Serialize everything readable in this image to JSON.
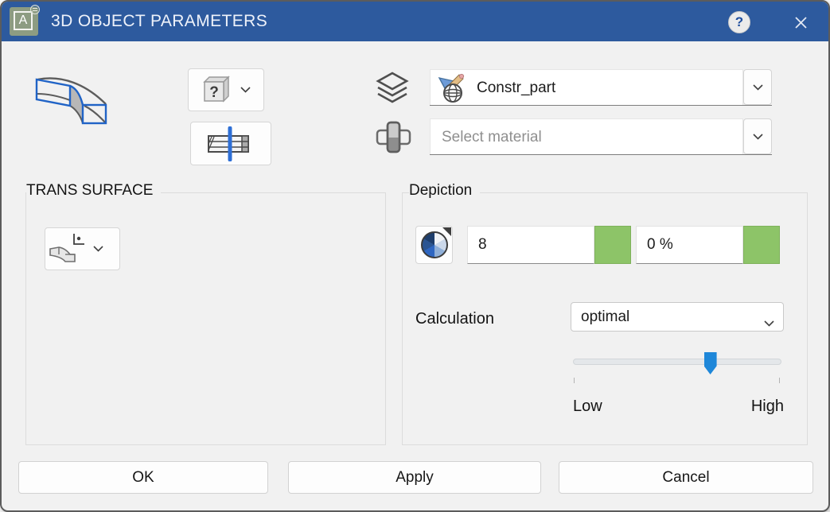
{
  "titlebar": {
    "app_letter": "A",
    "title": "3D OBJECT PARAMETERS",
    "help_glyph": "?"
  },
  "top_controls": {
    "cube_glyph": "?",
    "layer_combo": {
      "value": "Constr_part"
    },
    "material_combo": {
      "placeholder": "Select material"
    }
  },
  "trans_surface": {
    "label": "TRANS SURFACE"
  },
  "depiction": {
    "label": "Depiction",
    "pen_value": "8",
    "transparency_value": "0 %",
    "calculation_label": "Calculation",
    "calculation_value": "optimal",
    "slider": {
      "low": "Low",
      "high": "High",
      "value_percent": 66
    }
  },
  "footer": {
    "ok": "OK",
    "apply": "Apply",
    "cancel": "Cancel"
  },
  "colors": {
    "titlebar": "#2d5a9e",
    "swatch_green": "#8dc468",
    "slider_blue": "#1e87d9"
  }
}
